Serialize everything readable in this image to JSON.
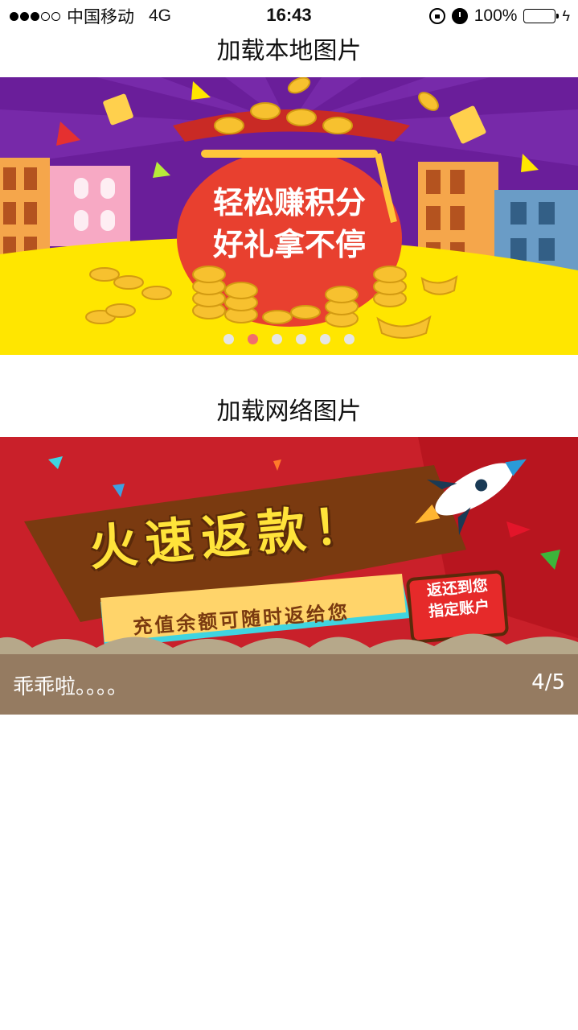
{
  "status_bar": {
    "carrier": "中国移动",
    "network": "4G",
    "time": "16:43",
    "battery": "100%",
    "signal_dots_filled": 3,
    "signal_dots_total": 5,
    "battery_color": "#4cd964"
  },
  "local_section": {
    "title": "加载本地图片",
    "banner_text_line1": "轻松赚积分",
    "banner_text_line2": "好礼拿不停",
    "page_count": 6,
    "active_page": 2,
    "active_dot_color": "#f26d6d"
  },
  "network_section": {
    "title": "加载网络图片",
    "banner_title": "火速返款！",
    "banner_subtitle": "充值余额可随时返给您",
    "banner_badge_line1": "返还到您",
    "banner_badge_line2": "指定账户",
    "caption": "乖乖啦。。。。",
    "page_indicator": "4/5"
  },
  "colors": {
    "banner_local_bg": "#6a1e9a",
    "banner_local_ground": "#ffe600",
    "bag_red": "#e8402f",
    "banner_net_bg": "#c9202a",
    "ribbon_brown": "#7a3a10",
    "cloud": "#b6a88a"
  }
}
